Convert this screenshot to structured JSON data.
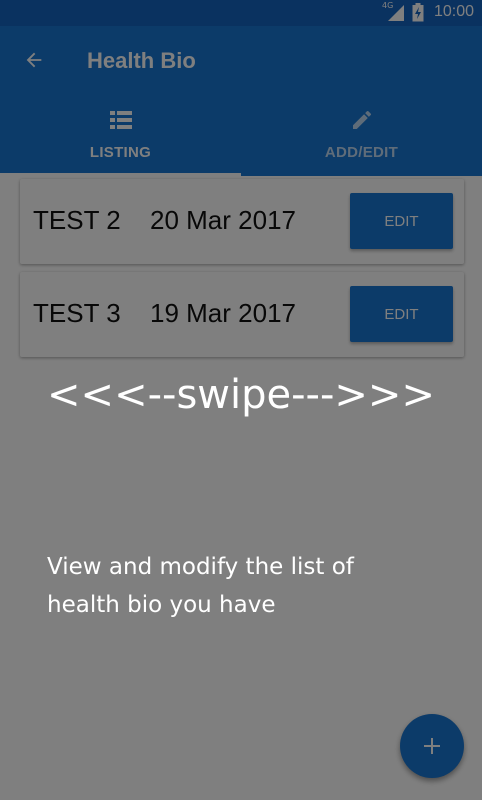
{
  "status_bar": {
    "network": "4G",
    "time": "10:00",
    "icons": [
      "signal-icon",
      "battery-icon"
    ]
  },
  "app_bar": {
    "title": "Health Bio",
    "back_icon": "arrow-back-icon"
  },
  "tabs": [
    {
      "label": "LISTING",
      "icon": "list-icon",
      "selected": true
    },
    {
      "label": "ADD/EDIT",
      "icon": "pencil-icon",
      "selected": false
    }
  ],
  "records": [
    {
      "name": "TEST 2",
      "date": "20 Mar 2017",
      "button_label": "EDIT"
    },
    {
      "name": "TEST 3",
      "date": "19 Mar 2017",
      "button_label": "EDIT"
    }
  ],
  "fab": {
    "label": "+",
    "icon": "plus-icon"
  },
  "overlay": {
    "swipe_text": "<<<--swipe--->>>",
    "description": "View and modify the list of health bio you have"
  },
  "colors": {
    "primary": "#1976D2",
    "primary_dark": "#1565C0",
    "scrim": "rgba(0,0,0,0.5)"
  }
}
